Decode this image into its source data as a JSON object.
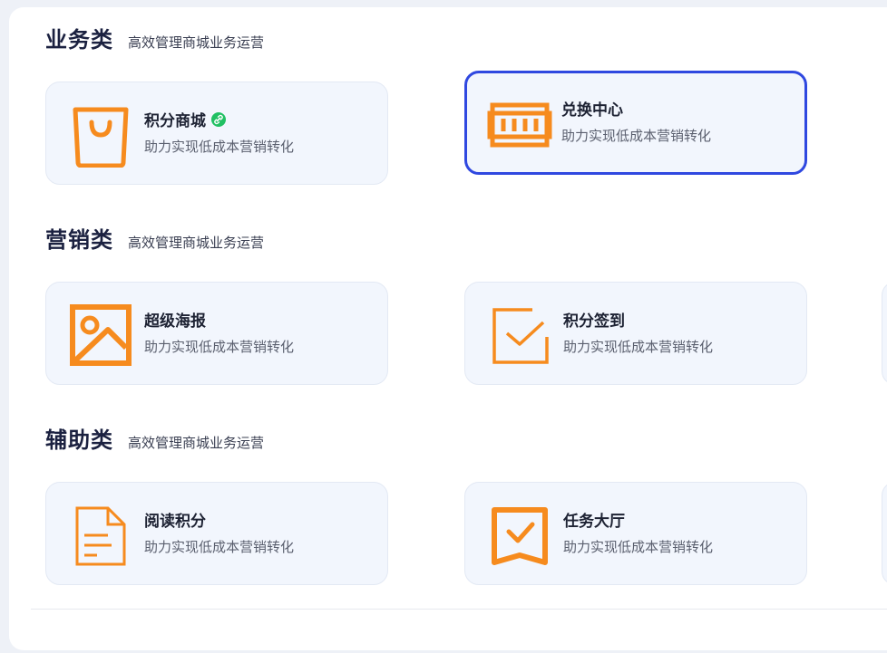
{
  "sections": [
    {
      "title": "业务类",
      "subtitle": "高效管理商城业务运营",
      "cards": [
        {
          "title": "积分商城",
          "desc": "助力实现低成本营销转化",
          "icon": "shopping-bag-icon",
          "badge": "link-icon"
        },
        {
          "title": "兑换中心",
          "desc": "助力实现低成本营销转化",
          "icon": "exchange-ticket-icon",
          "selected": true
        }
      ]
    },
    {
      "title": "营销类",
      "subtitle": "高效管理商城业务运营",
      "cards": [
        {
          "title": "超级海报",
          "desc": "助力实现低成本营销转化",
          "icon": "image-poster-icon"
        },
        {
          "title": "积分签到",
          "desc": "助力实现低成本营销转化",
          "icon": "checkbox-sign-icon"
        }
      ]
    },
    {
      "title": "辅助类",
      "subtitle": "高效管理商城业务运营",
      "cards": [
        {
          "title": "阅读积分",
          "desc": "助力实现低成本营销转化",
          "icon": "document-icon"
        },
        {
          "title": "任务大厅",
          "desc": "助力实现低成本营销转化",
          "icon": "task-flag-icon"
        }
      ]
    }
  ],
  "colors": {
    "accent": "#f68b1e",
    "selected_border": "#2f48e0",
    "badge": "#21c063",
    "card_bg": "#f2f6fd"
  }
}
